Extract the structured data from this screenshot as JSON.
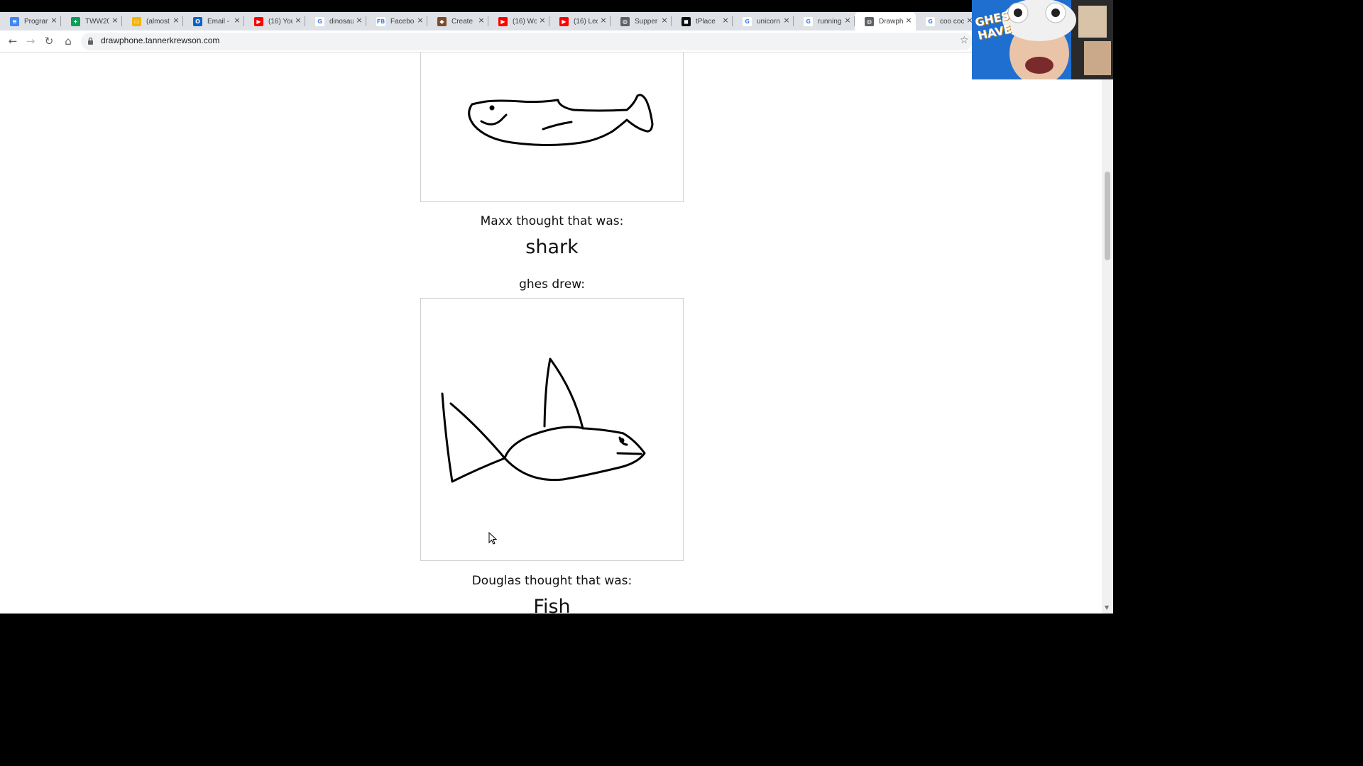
{
  "browser": {
    "tabs": [
      {
        "title": "Progran",
        "icon": "google-docs-icon",
        "color": "#4285f4",
        "glyph": "≡"
      },
      {
        "title": "TWW20",
        "icon": "google-sheets-icon",
        "color": "#0f9d58",
        "glyph": "+"
      },
      {
        "title": "(almost",
        "icon": "google-slides-icon",
        "color": "#f4b400",
        "glyph": "▭"
      },
      {
        "title": "Email -",
        "icon": "outlook-icon",
        "color": "#0a64c8",
        "glyph": "O"
      },
      {
        "title": "(16) You",
        "icon": "youtube-icon",
        "color": "#ff0000",
        "glyph": "▶"
      },
      {
        "title": "dinosau",
        "icon": "google-icon",
        "color": "#ffffff",
        "glyph": "G"
      },
      {
        "title": "Facebo",
        "icon": "facebook-icon",
        "color": "#ffffff",
        "glyph": "FB"
      },
      {
        "title": "Create",
        "icon": "shield-icon",
        "color": "#7a4e2d",
        "glyph": "◆"
      },
      {
        "title": "(16) Wo",
        "icon": "youtube-icon",
        "color": "#ff0000",
        "glyph": "▶"
      },
      {
        "title": "(16) Lec",
        "icon": "youtube-icon",
        "color": "#ff0000",
        "glyph": "▶"
      },
      {
        "title": "Supper",
        "icon": "globe-icon",
        "color": "#5f6368",
        "glyph": "◍"
      },
      {
        "title": "tPlace",
        "icon": "tplace-icon",
        "color": "#111111",
        "glyph": "◼"
      },
      {
        "title": "unicorn",
        "icon": "google-icon",
        "color": "#ffffff",
        "glyph": "G"
      },
      {
        "title": "running",
        "icon": "google-icon",
        "color": "#ffffff",
        "glyph": "G"
      },
      {
        "title": "Drawph",
        "icon": "globe-icon",
        "color": "#5f6368",
        "glyph": "◍",
        "active": true
      },
      {
        "title": "coo coc",
        "icon": "google-icon",
        "color": "#ffffff",
        "glyph": "G"
      }
    ],
    "url": "drawphone.tannerkrewson.com"
  },
  "game": {
    "guess1_intro": "Maxx thought that was:",
    "guess1_word": "shark",
    "drawer_label": "ghes drew:",
    "guess2_intro": "Douglas thought that was:",
    "guess2_word": "Fish"
  },
  "webcam": {
    "overlay_text": "GHES HAVE"
  }
}
